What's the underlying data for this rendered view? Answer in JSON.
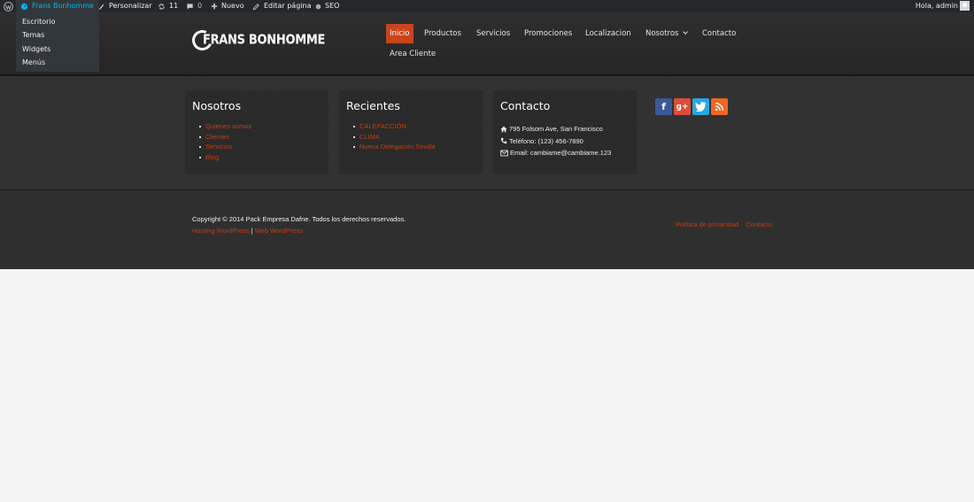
{
  "adminbar": {
    "site_name": "Frans Bonhomme",
    "customize": "Personalizar",
    "updates_count": "11",
    "comments_count": "0",
    "new_label": "Nuevo",
    "edit_page": "Editar página",
    "seo": "SEO",
    "greeting": "Hola, admin",
    "site_menu": [
      "Escritorio",
      "Temas",
      "Widgets",
      "Menús"
    ]
  },
  "header": {
    "logo_text": "FRANS BONHOMME",
    "nav": [
      "Inicio",
      "Productos",
      "Servicios",
      "Promociones",
      "Localizacion",
      "Nosotros",
      "Contacto",
      "Area Cliente"
    ],
    "active_index": 0
  },
  "widgets": {
    "nosotros": {
      "title": "Nosotros",
      "links": [
        "Quienes somos",
        "Clientes",
        "Servicios",
        "Blog"
      ]
    },
    "recientes": {
      "title": "Recientes",
      "links": [
        "CALEFACCIÓN",
        "CLIMA",
        "Nueva Delegación Sevilla"
      ]
    },
    "contacto": {
      "title": "Contacto",
      "address": "795 Folsom Ave, San Francisco",
      "phone": "Teléfono: (123) 456-7890",
      "email": "Email: cambiame@cambiame.123"
    },
    "social": [
      "facebook-icon",
      "google-plus-icon",
      "twitter-icon",
      "rss-icon"
    ]
  },
  "footer": {
    "copyright": "Copyright © 2014 Pack Empresa Dafne. Todos los derechos reservados.",
    "hosting_link": "Hosting WordPress",
    "separator": "|",
    "web_link": "Web WordPress",
    "privacy_link": "Política de privacidad",
    "contact_link": "Contacto"
  },
  "colors": {
    "accent": "#c8441c",
    "link": "#c33e15",
    "adminbar_bg": "#23282d",
    "admin_link": "#00b9eb"
  }
}
